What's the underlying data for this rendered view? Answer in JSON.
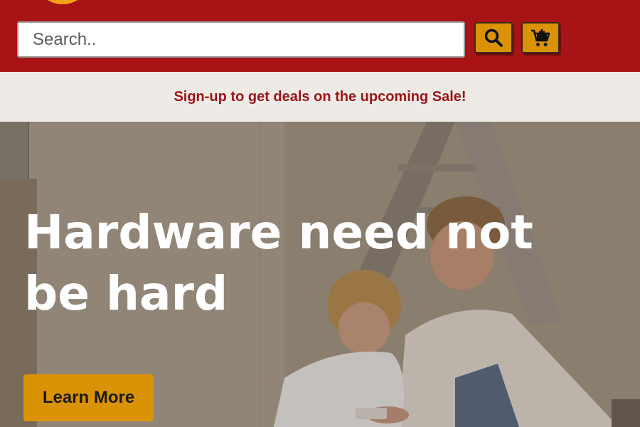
{
  "header": {
    "brand_color": "#a81415",
    "logo_color": "#f5a21b",
    "search": {
      "placeholder": "Search..",
      "value": ""
    },
    "search_button_icon": "search-icon",
    "cart_button_icon": "cart-add-icon",
    "button_color": "#d99304"
  },
  "promo": {
    "text": "Sign-up to get deals on the upcoming Sale!",
    "text_color": "#9e1416",
    "background": "#eeebe7"
  },
  "hero": {
    "title": "Hardware need not be hard",
    "cta_label": "Learn More",
    "image": "photo-woman-and-child-with-ladder"
  }
}
